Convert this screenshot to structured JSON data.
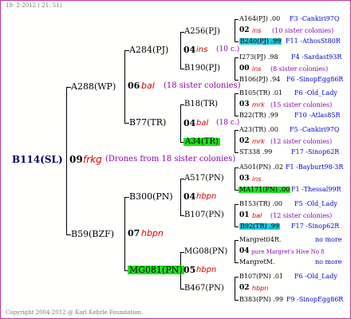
{
  "header": {
    "date_text": "18-  2-2012 ( 21: 51)"
  },
  "footer": {
    "copyright": "Copyright 2004-2012 @ Karl Kehrle Foundation."
  },
  "root": {
    "label": "B114(SL)"
  },
  "gen1": {
    "main": {
      "year": "09",
      "breeder": "frkg",
      "note": "(Drones from 18 sister colonies)"
    },
    "top": {
      "label": "A288(WP)"
    },
    "bottom": {
      "label": "B59(BZF)"
    }
  },
  "gen2": {
    "a288": {
      "year": "06",
      "breeder": "bal",
      "note": "(18 sister colonies)",
      "top": "A284(PJ)",
      "bottom": "B77(TR)"
    },
    "b59": {
      "year": "07",
      "breeder": "hbpn",
      "top": "B300(PN)",
      "bottom": "MG081(PN)"
    }
  },
  "gen3": {
    "a284": {
      "year": "04",
      "breeder": "ins",
      "note": "(10 c.)",
      "top": "A256(PJ)",
      "bottom": "B190(PJ)"
    },
    "b77": {
      "year": "04",
      "breeder": "bal",
      "note": "(18 c.)",
      "top": "B18(TR)",
      "bottom": "A34(TR)"
    },
    "b300": {
      "year": "04",
      "breeder": "hbpn",
      "top": "A517(PN)",
      "bottom": "B107(PN)"
    },
    "mg081": {
      "year": "05",
      "breeder": "hbpn",
      "top": "MG08(PN)",
      "bottom": "B467(PN)"
    }
  },
  "gen4": {
    "a256": {
      "top_id": "A164(PJ)",
      "top_yr": ".00",
      "top_right": "F3 -Cankiri97Q",
      "year": "02",
      "breeder": "ins",
      "note": "(10 sister colonies)",
      "bottom_id": "B240(PJ)",
      "bottom_yr": ".99",
      "bottom_right": "F11 -AthosSt80R"
    },
    "b190": {
      "top_id": "I273(PJ)",
      "top_yr": ".98",
      "top_right": "F4 -Sardast93R",
      "year": "00",
      "breeder": "ins",
      "note": "(8 sister colonies)",
      "bottom_id": "B106(PJ)",
      "bottom_yr": ".94",
      "bottom_right": "F6 -SinopEgg86R"
    },
    "b18": {
      "top_id": "B105(TR)",
      "top_yr": ".01",
      "top_right": "F6 -Old_Lady",
      "year": "03",
      "breeder": "mrk",
      "note": "(15 sister colonies)",
      "bottom_id": "B22(TR)",
      "bottom_yr": ".99",
      "bottom_right": "F10 -Atlas85R"
    },
    "a34": {
      "top_id": "A23(TR)",
      "top_yr": ".00",
      "top_right": "F5 -Cankiri97Q",
      "year": "02",
      "breeder": "mrk",
      "note": "(12 sister colonies)",
      "bottom_id": "ST338",
      "bottom_yr": ".99",
      "bottom_right": "F17 -Sinop62R"
    },
    "a517": {
      "top_id": "A501(PN)",
      "top_yr": ".02",
      "top_right": "F1 -Bayburt98-3R",
      "year": "03",
      "breeder": "ins",
      "note": "",
      "bottom_id": "MA171(PN)",
      "bottom_yr": ".00",
      "bottom_right": "F1 -Thessal99R"
    },
    "b107": {
      "top_id": "B153(TR)",
      "top_yr": ".00",
      "top_right": "F5 -Old_Lady",
      "year": "01",
      "breeder": "bal",
      "note": "(12 sister colonies)",
      "bottom_id": "B92(TR)",
      "bottom_yr": ".99",
      "bottom_right": "F17 -Sinop62R"
    },
    "mg08": {
      "top_id": "Margret04R",
      "top_yr": ".",
      "top_right": "no more",
      "year": "04",
      "note": "pure Margret's Hive No 8",
      "bottom_id": "MargretM",
      "bottom_yr": ".",
      "bottom_right": "no more"
    },
    "b467": {
      "top_id": "B107(PN)",
      "top_yr": ".01",
      "top_right": "F6 -Old_Lady",
      "year": "02",
      "breeder": "hbpn",
      "note": "",
      "bottom_id": "B383(PN)",
      "bottom_yr": ".99",
      "bottom_right": "F9 -SinopEgg86R"
    }
  }
}
